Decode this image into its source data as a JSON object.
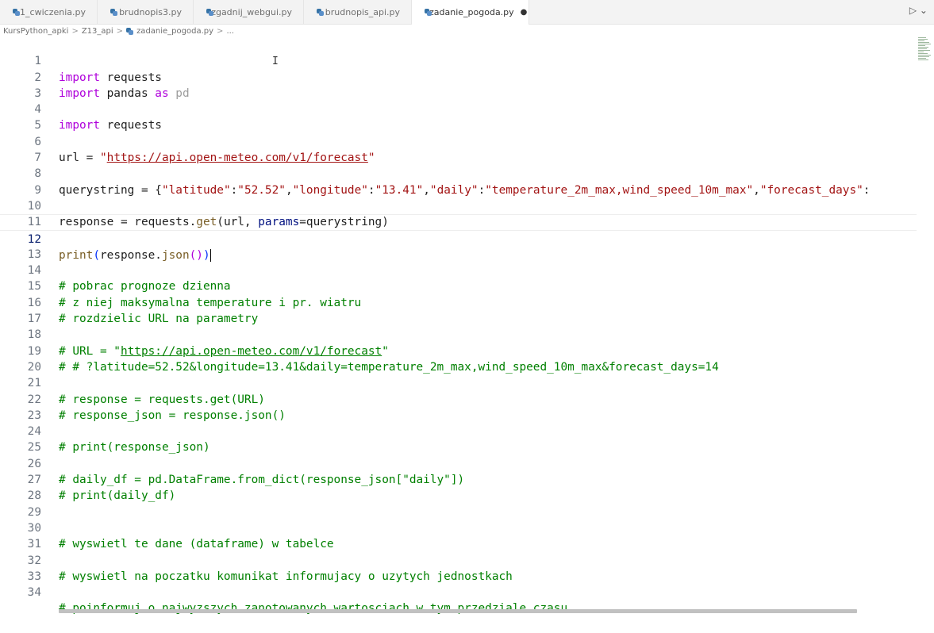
{
  "tabs": [
    {
      "label": "1_cwiczenia.py"
    },
    {
      "label": "brudnopis3.py"
    },
    {
      "label": "zgadnij_webgui.py"
    },
    {
      "label": "brudnopis_api.py"
    },
    {
      "label": "zadanie_pogoda.py",
      "active": true,
      "dirty_marker": "●"
    }
  ],
  "run_button": "▷ ⌄",
  "breadcrumbs": {
    "part1": "KursPython_apki",
    "sep": ">",
    "part2": "Z13_api",
    "part3": "zadanie_pogoda.py",
    "part4": "..."
  },
  "editor": {
    "active_line": 12,
    "lines": {
      "l1": {
        "n": "1"
      },
      "l2": {
        "n": "2"
      },
      "l3": {
        "n": "3"
      },
      "l4": {
        "n": "4"
      },
      "l5": {
        "n": "5"
      },
      "l6": {
        "n": "6"
      },
      "l7": {
        "n": "7"
      },
      "l8": {
        "n": "8"
      },
      "l9": {
        "n": "9"
      },
      "l10": {
        "n": "10"
      },
      "l11": {
        "n": "11"
      },
      "l12": {
        "n": "12"
      },
      "l13": {
        "n": "13"
      },
      "l14": {
        "n": "14"
      },
      "l15": {
        "n": "15"
      },
      "l16": {
        "n": "16"
      },
      "l17": {
        "n": "17"
      },
      "l18": {
        "n": "18"
      },
      "l19": {
        "n": "19"
      },
      "l20": {
        "n": "20"
      },
      "l21": {
        "n": "21"
      },
      "l22": {
        "n": "22"
      },
      "l23": {
        "n": "23"
      },
      "l24": {
        "n": "24"
      },
      "l25": {
        "n": "25"
      },
      "l26": {
        "n": "26"
      },
      "l27": {
        "n": "27"
      },
      "l28": {
        "n": "28"
      },
      "l29": {
        "n": "29"
      },
      "l30": {
        "n": "30"
      },
      "l31": {
        "n": "31"
      },
      "l32": {
        "n": "32"
      },
      "l33": {
        "n": "33"
      },
      "l34": {
        "n": "34"
      }
    },
    "tokens": {
      "import": "import",
      "requests": " requests",
      "pandas": " pandas ",
      "as": "as",
      "pd": " pd",
      "url_assign": "url = ",
      "quote": "\"",
      "api_url": "https://api.open-meteo.com/v1/forecast",
      "qs_assign": "querystring = {",
      "qs_lat_k": "\"latitude\"",
      "colon": ":",
      "comma": ",",
      "qs_lat_v": "\"52.52\"",
      "qs_lon_k": "\"longitude\"",
      "qs_lon_v": "\"13.41\"",
      "qs_daily_k": "\"daily\"",
      "qs_daily_v": "\"temperature_2m_max,wind_speed_10m_max\"",
      "qs_fd_k": "\"forecast_days\"",
      "resp_assign": "response = requests.",
      "get": "get",
      "get_args_open": "(url, ",
      "params": "params",
      "get_args_close": "=querystring)",
      "print": "print",
      "open_paren": "(",
      "resp_json": "response.",
      "json": "json",
      "empty_parens": "()",
      "close_paren": ")",
      "c14": "# pobrac prognoze dzienna",
      "c15": "# z niej maksymalna temperature i pr. wiatru",
      "c16": "# rozdzielic URL na parametry",
      "c18a": "# URL = \"",
      "c18b": "https://api.open-meteo.com/v1/forecast",
      "c18c": "\"",
      "c19": "# # ?latitude=52.52&longitude=13.41&daily=temperature_2m_max,wind_speed_10m_max&forecast_days=14",
      "c21": "# response = requests.get(URL)",
      "c22": "# response_json = response.json()",
      "c24": "# print(response_json)",
      "c26": "# daily_df = pd.DataFrame.from_dict(response_json[\"daily\"])",
      "c27": "# print(daily_df)",
      "c30": "# wyswietl te dane (dataframe) w tabelce",
      "c32": "# wyswietl na poczatku komunikat informujacy o uzytych jednostkach",
      "c34": "# poinformuj o najwyzszych zanotowanych wartosciach w tym przedziale czasu"
    }
  },
  "mouse_cursor_glyph": "I",
  "colors": {
    "keyword": "#af00db",
    "string": "#a31515",
    "comment": "#008000",
    "function": "#795e26",
    "parameter": "#001080"
  }
}
